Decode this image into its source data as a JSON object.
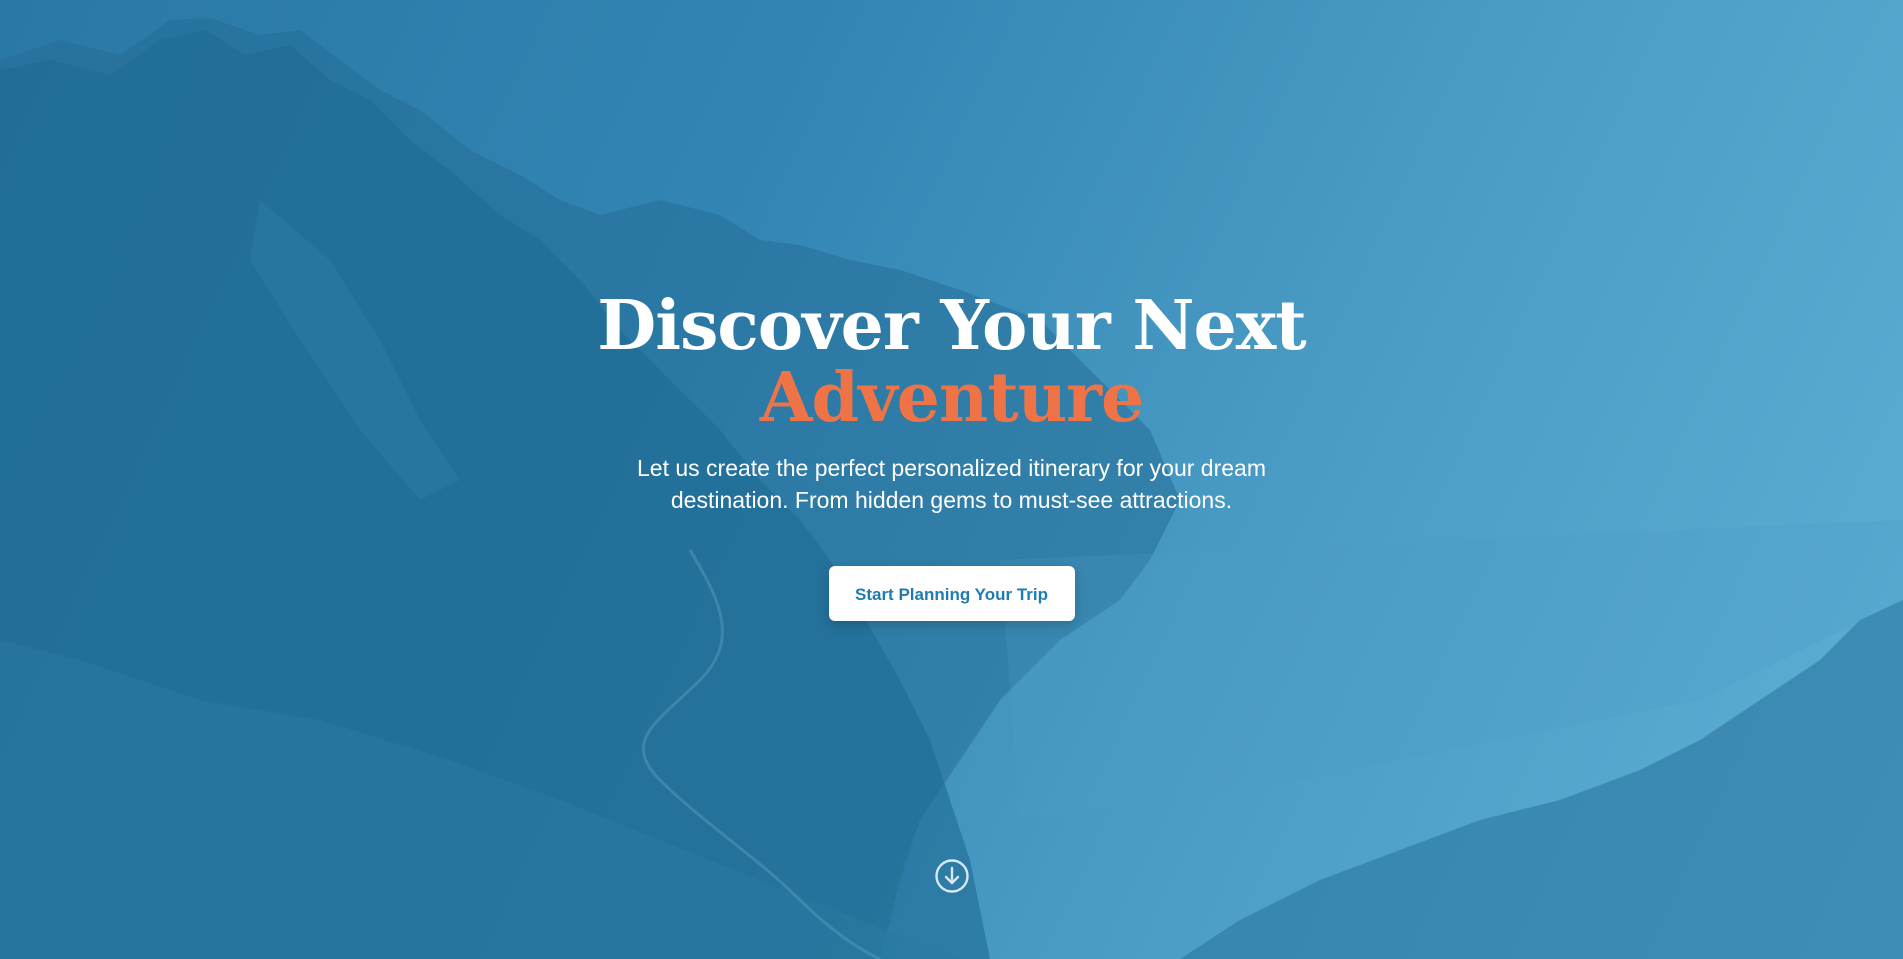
{
  "hero": {
    "title_line1": "Discover Your Next",
    "title_accent": "Adventure",
    "subtitle": "Let us create the perfect personalized itinerary for your dream destination. From hidden gems to must-see attractions.",
    "cta_label": "Start Planning Your Trip"
  },
  "icons": {
    "scroll_down": "arrow-down-circle-icon"
  },
  "colors": {
    "overlay": "#3285b3",
    "accent": "#ee7448",
    "button_text": "#1e7dae"
  }
}
